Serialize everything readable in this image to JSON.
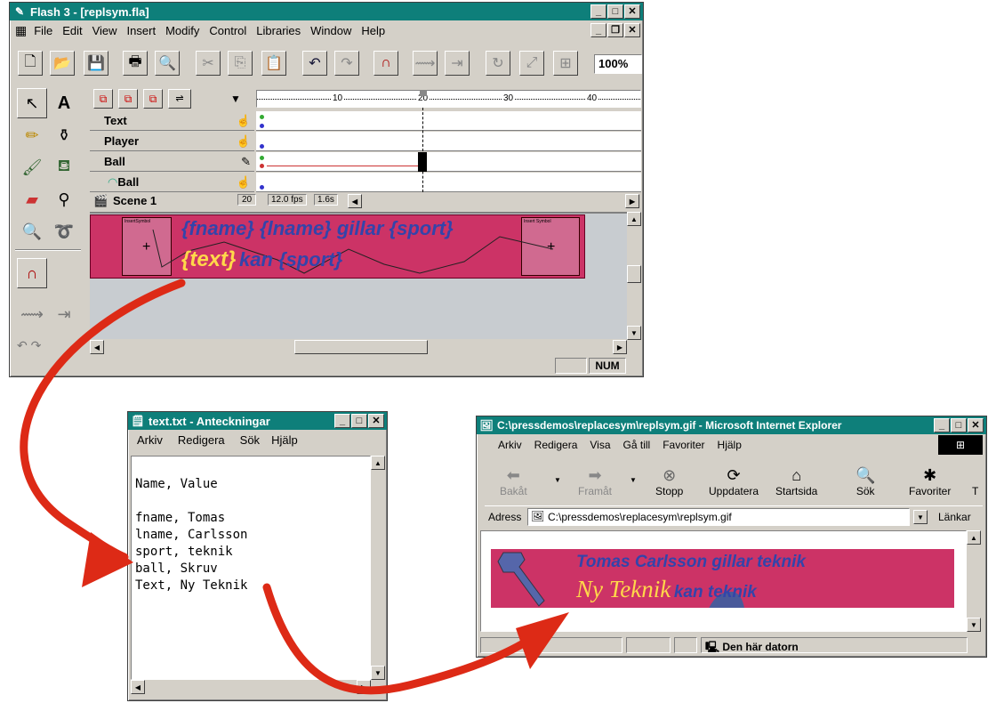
{
  "flash": {
    "title": "Flash 3 - [replsym.fla]",
    "menu": [
      "File",
      "Edit",
      "View",
      "Insert",
      "Modify",
      "Control",
      "Libraries",
      "Window",
      "Help"
    ],
    "zoom": "100%",
    "layers": [
      "Text",
      "Player",
      "Ball",
      "Ball"
    ],
    "scene": "Scene 1",
    "frame": "20",
    "fps": "12.0 fps",
    "time": "1.6s",
    "ruler": [
      "10",
      "20",
      "30",
      "40"
    ],
    "stage_line1": "{fname} {lname} gillar {sport}",
    "stage_line2_a": "{text}",
    "stage_line2_b": "kan {sport}",
    "symbol_left": "InsertSymbol",
    "symbol_right": "Insert Symbol",
    "status": "NUM"
  },
  "notepad": {
    "title": "text.txt - Anteckningar",
    "menu": [
      "Arkiv",
      "Redigera",
      "Sök",
      "Hjälp"
    ],
    "lines": [
      "Name, Value",
      "",
      "fname, Tomas",
      "lname, Carlsson",
      "sport, teknik",
      "ball, Skruv",
      "Text, Ny Teknik"
    ]
  },
  "ie": {
    "title": "C:\\pressdemos\\replacesym\\replsym.gif - Microsoft Internet Explorer",
    "menu": [
      "Arkiv",
      "Redigera",
      "Visa",
      "Gå till",
      "Favoriter",
      "Hjälp"
    ],
    "toolbar": [
      "Bakåt",
      "Framåt",
      "Stopp",
      "Uppdatera",
      "Startsida",
      "Sök",
      "Favoriter",
      "T"
    ],
    "address_label": "Adress",
    "address": "C:\\pressdemos\\replacesym\\replsym.gif",
    "links": "Länkar",
    "banner_line1": "Tomas Carlsson gillar teknik",
    "banner_line2_a": "Ny Teknik",
    "banner_line2_b": "kan teknik",
    "status": "Den här datorn"
  },
  "colors": {
    "titlebar": "#0e7f7a",
    "banner": "#cc3366",
    "banner_text_blue": "#3344aa",
    "banner_text_yellow": "#ffd84a",
    "arrow": "#dd2a16"
  }
}
